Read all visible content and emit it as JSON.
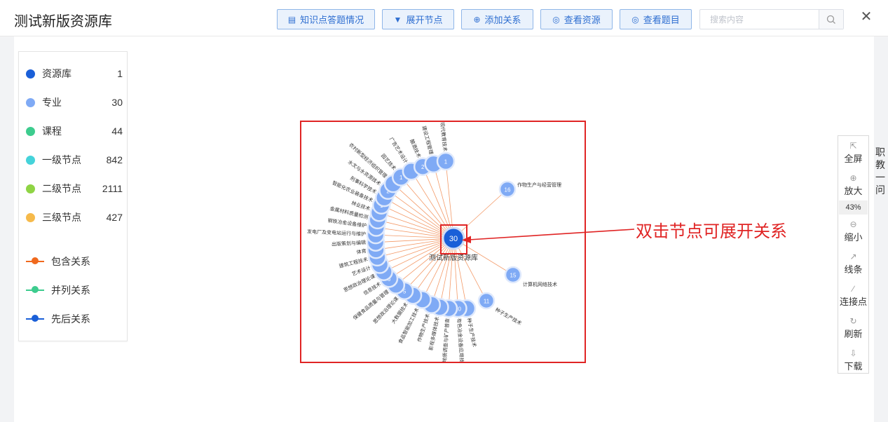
{
  "header": {
    "title": "测试新版资源库",
    "buttons": [
      {
        "label": "知识点答题情况",
        "icon": "document-icon"
      },
      {
        "label": "展开节点",
        "icon": "caret-down-icon"
      },
      {
        "label": "添加关系",
        "icon": "plus-circle-icon"
      },
      {
        "label": "查看资源",
        "icon": "eye-icon"
      },
      {
        "label": "查看题目",
        "icon": "eye-icon"
      }
    ],
    "search_placeholder": "搜索内容",
    "search_value": "",
    "close_icon": "close-icon"
  },
  "legend": {
    "nodes": [
      {
        "label": "资源库",
        "count": "1",
        "color": "#1a5fd8"
      },
      {
        "label": "专业",
        "count": "30",
        "color": "#7faaf5"
      },
      {
        "label": "课程",
        "count": "44",
        "color": "#3dcc8e"
      },
      {
        "label": "一级节点",
        "count": "842",
        "color": "#45d3da"
      },
      {
        "label": "二级节点",
        "count": "2111",
        "color": "#8fd444"
      },
      {
        "label": "三级节点",
        "count": "427",
        "color": "#f6ba4b"
      }
    ],
    "relations": [
      {
        "label": "包含关系",
        "color": "#f0691d"
      },
      {
        "label": "并列关系",
        "color": "#3dcc8e"
      },
      {
        "label": "先后关系",
        "color": "#1a5fd8"
      }
    ]
  },
  "graph": {
    "center": {
      "value": "30",
      "label": "测试新版资源库"
    },
    "arc_labels": [
      "现代教育技术",
      "建设工程管理",
      "酿酒技术",
      "广告艺术设计",
      "园艺技术",
      "农村新型经济组织管理",
      "水文与水资源技术",
      "刑事科学技术",
      "智能化农业装备技术",
      "林业技术",
      "金属材料质量检测",
      "钢铁冶金设备维护",
      "发电厂及变电站运行与维护",
      "出版策划与编辑",
      "体育",
      "建筑工程技术",
      "艺术设计",
      "思想政治理论课",
      "信息技术",
      "保健食品质量与管理",
      "思想政治理论课",
      "大数据技术",
      "食品智能加工技术",
      "作物生产技术",
      "影视多媒体技术",
      "地质调查与矿产普查",
      "有色冶金设备应用技术",
      "种子生产技术"
    ],
    "outer_nodes": [
      {
        "value": "16",
        "label": "作物生产与经营管理"
      },
      {
        "value": "15",
        "label": "计算机网络技术"
      },
      {
        "value": "11",
        "label": "种子生产技术"
      }
    ],
    "visible_node_numbers": [
      "1",
      "2",
      "1",
      "2",
      "1",
      "6",
      "5",
      "10"
    ]
  },
  "annotation": "双击节点可展开关系",
  "toolbox": {
    "items": [
      {
        "label": "全屏",
        "icon": "fullscreen-icon"
      },
      {
        "label": "放大",
        "icon": "zoom-in-icon"
      },
      {
        "label": "缩小",
        "icon": "zoom-out-icon"
      },
      {
        "label": "线条",
        "icon": "line-chart-icon"
      },
      {
        "label": "连接点",
        "icon": "link-point-icon"
      },
      {
        "label": "刷新",
        "icon": "refresh-icon"
      },
      {
        "label": "下载",
        "icon": "download-icon"
      }
    ],
    "zoom": "43%"
  },
  "side_text": [
    "职",
    "教",
    "一",
    "问"
  ]
}
